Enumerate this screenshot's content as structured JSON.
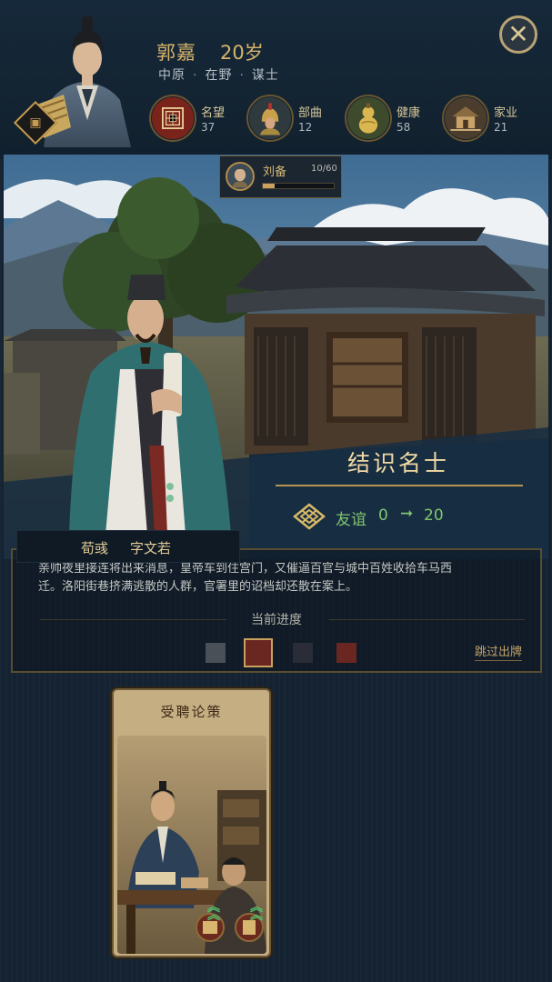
{
  "character": {
    "name": "郭嘉",
    "age": "20岁",
    "region": "中原",
    "status": "在野",
    "role": "谋士",
    "separator": "·"
  },
  "stats": [
    {
      "label": "名望",
      "value": "37",
      "icon": "scroll-seal-icon"
    },
    {
      "label": "部曲",
      "value": "12",
      "icon": "soldier-helmet-icon"
    },
    {
      "label": "健康",
      "value": "58",
      "icon": "gourd-icon"
    },
    {
      "label": "家业",
      "value": "21",
      "icon": "house-icon"
    }
  ],
  "lord": {
    "name": "刘备",
    "count": "10/60",
    "progress_fraction": 0.1667
  },
  "close": {
    "glyph": "✕"
  },
  "event": {
    "title": "结识名士",
    "reward_label": "友谊",
    "reward_from": "0",
    "reward_arrow": "➞",
    "reward_to": "20"
  },
  "npc": {
    "name": "荀彧",
    "courtesy": "字文若"
  },
  "story": {
    "line1": "亲帅夜里接连将出来消息，皇帝车到住宫门，又催逼百官与城中百姓收拾车马西",
    "line2": "迁。洛阳街巷挤满逃散的人群，官署里的诏档却还散在案上。"
  },
  "progress": {
    "title": "当前进度",
    "skip": "跳过出牌",
    "cells": [
      {
        "color": "#4a5057",
        "selected": false
      },
      {
        "color": "#6a2620",
        "selected": true
      },
      {
        "color": "#2a2c38",
        "selected": false
      },
      {
        "color": "#6a2620",
        "selected": false
      }
    ]
  },
  "card": {
    "title": "受聘论策"
  },
  "colors": {
    "gold": "#d7b46a",
    "green": "#80c46f",
    "panel": "#142231"
  }
}
